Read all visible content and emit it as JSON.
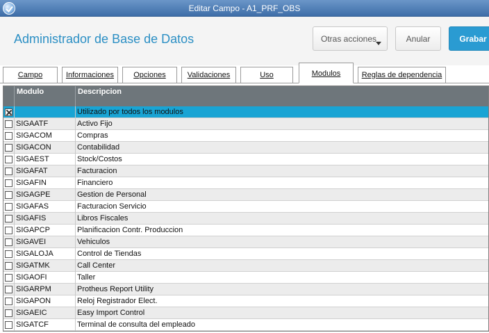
{
  "window": {
    "title": "Editar Campo - A1_PRF_OBS",
    "icon": "app-logo-icon"
  },
  "header": {
    "title": "Administrador de Base de Datos",
    "otras_acciones": "Otras acciones",
    "anular": "Anular",
    "grabar": "Grabar",
    "accent": "#2a9bd2"
  },
  "tabs": [
    {
      "label": "Campo"
    },
    {
      "label": "Informaciones"
    },
    {
      "label": "Opciones"
    },
    {
      "label": "Validaciones"
    },
    {
      "label": "Uso"
    },
    {
      "label": "Modulos"
    },
    {
      "label": "Reglas de dependencia"
    }
  ],
  "active_tab": "Modulos",
  "grid": {
    "columns": [
      "Modulo",
      "Descripcion"
    ],
    "rows": [
      {
        "checked": true,
        "modulo": "",
        "descripcion": "Utilizado por todos los modulos"
      },
      {
        "checked": false,
        "modulo": "SIGAATF",
        "descripcion": "Activo Fijo"
      },
      {
        "checked": false,
        "modulo": "SIGACOM",
        "descripcion": "Compras"
      },
      {
        "checked": false,
        "modulo": "SIGACON",
        "descripcion": "Contabilidad"
      },
      {
        "checked": false,
        "modulo": "SIGAEST",
        "descripcion": "Stock/Costos"
      },
      {
        "checked": false,
        "modulo": "SIGAFAT",
        "descripcion": "Facturacion"
      },
      {
        "checked": false,
        "modulo": "SIGAFIN",
        "descripcion": "Financiero"
      },
      {
        "checked": false,
        "modulo": "SIGAGPE",
        "descripcion": "Gestion de Personal"
      },
      {
        "checked": false,
        "modulo": "SIGAFAS",
        "descripcion": "Facturacion Servicio"
      },
      {
        "checked": false,
        "modulo": "SIGAFIS",
        "descripcion": "Libros Fiscales"
      },
      {
        "checked": false,
        "modulo": "SIGAPCP",
        "descripcion": "Planificacion Contr. Produccion"
      },
      {
        "checked": false,
        "modulo": "SIGAVEI",
        "descripcion": "Vehiculos"
      },
      {
        "checked": false,
        "modulo": "SIGALOJA",
        "descripcion": "Control de Tiendas"
      },
      {
        "checked": false,
        "modulo": "SIGATMK",
        "descripcion": "Call Center"
      },
      {
        "checked": false,
        "modulo": "SIGAOFI",
        "descripcion": "Taller"
      },
      {
        "checked": false,
        "modulo": "SIGARPM",
        "descripcion": "Protheus Report Utility"
      },
      {
        "checked": false,
        "modulo": "SIGAPON",
        "descripcion": "Reloj Registrador Elect."
      },
      {
        "checked": false,
        "modulo": "SIGAEIC",
        "descripcion": "Easy Import Control"
      },
      {
        "checked": false,
        "modulo": "SIGATCF",
        "descripcion": "Terminal de consulta del empleado"
      }
    ]
  }
}
